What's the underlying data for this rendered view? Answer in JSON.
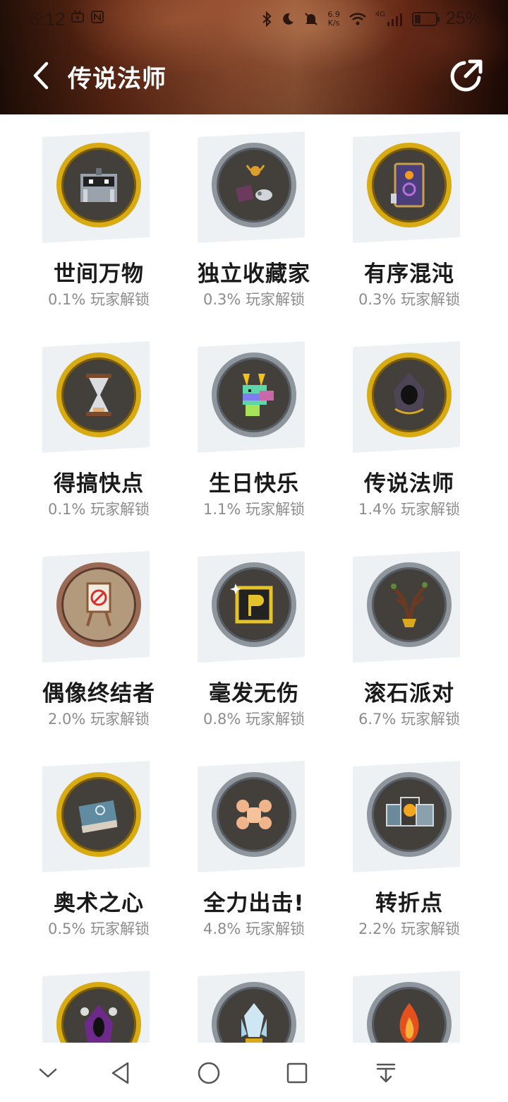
{
  "status_bar": {
    "time": "6:12",
    "speed_value": "6.9",
    "speed_unit": "K/s",
    "network": "4G",
    "battery": "25%"
  },
  "header": {
    "title": "传说法师",
    "back_icon": "chevron-left-icon",
    "share_icon": "share-icon"
  },
  "achievements": [
    {
      "title": "世间万物",
      "subtitle": "0.1% 玩家解锁",
      "ring": "gold",
      "icon": "treasure-chest-icon"
    },
    {
      "title": "独立收藏家",
      "subtitle": "0.3% 玩家解锁",
      "ring": "silver",
      "icon": "collectibles-icon"
    },
    {
      "title": "有序混沌",
      "subtitle": "0.3% 玩家解锁",
      "ring": "gold",
      "icon": "spell-card-icon"
    },
    {
      "title": "得搞快点",
      "subtitle": "0.1% 玩家解锁",
      "ring": "gold",
      "icon": "hourglass-icon"
    },
    {
      "title": "生日快乐",
      "subtitle": "1.1% 玩家解锁",
      "ring": "silver",
      "icon": "rainbow-llama-icon"
    },
    {
      "title": "传说法师",
      "subtitle": "1.4% 玩家解锁",
      "ring": "gold",
      "icon": "hooded-wizard-icon"
    },
    {
      "title": "偶像终结者",
      "subtitle": "2.0% 玩家解锁",
      "ring": "bronze",
      "icon": "easel-sign-icon"
    },
    {
      "title": "毫发无伤",
      "subtitle": "0.8% 玩家解锁",
      "ring": "silver",
      "icon": "p-block-icon"
    },
    {
      "title": "滚石派对",
      "subtitle": "6.7% 玩家解锁",
      "ring": "silver",
      "icon": "treant-mask-icon"
    },
    {
      "title": "奥术之心",
      "subtitle": "0.5% 玩家解锁",
      "ring": "gold",
      "icon": "spellbook-icon"
    },
    {
      "title": "全力出击!",
      "subtitle": "4.8% 玩家解锁",
      "ring": "silver",
      "icon": "fists-icon"
    },
    {
      "title": "转折点",
      "subtitle": "2.2% 玩家解锁",
      "ring": "silver",
      "icon": "cards-icon"
    },
    {
      "title": "",
      "subtitle": "",
      "ring": "gold",
      "icon": "shadow-mage-icon"
    },
    {
      "title": "",
      "subtitle": "",
      "ring": "silver",
      "icon": "crystal-icon"
    },
    {
      "title": "",
      "subtitle": "",
      "ring": "silver",
      "icon": "flame-icon"
    }
  ],
  "nav_bar": {
    "icons": [
      "collapse-icon",
      "back-triangle-icon",
      "home-circle-icon",
      "recents-square-icon",
      "pull-down-icon"
    ]
  },
  "colors": {
    "gold_ring": "#d8ab13",
    "silver_ring": "#8e959c",
    "bronze_ring": "#9b6a55",
    "badge_fill": "#43403b",
    "title_text": "#1a1a1a",
    "subtitle_text": "#8c8c8c"
  }
}
